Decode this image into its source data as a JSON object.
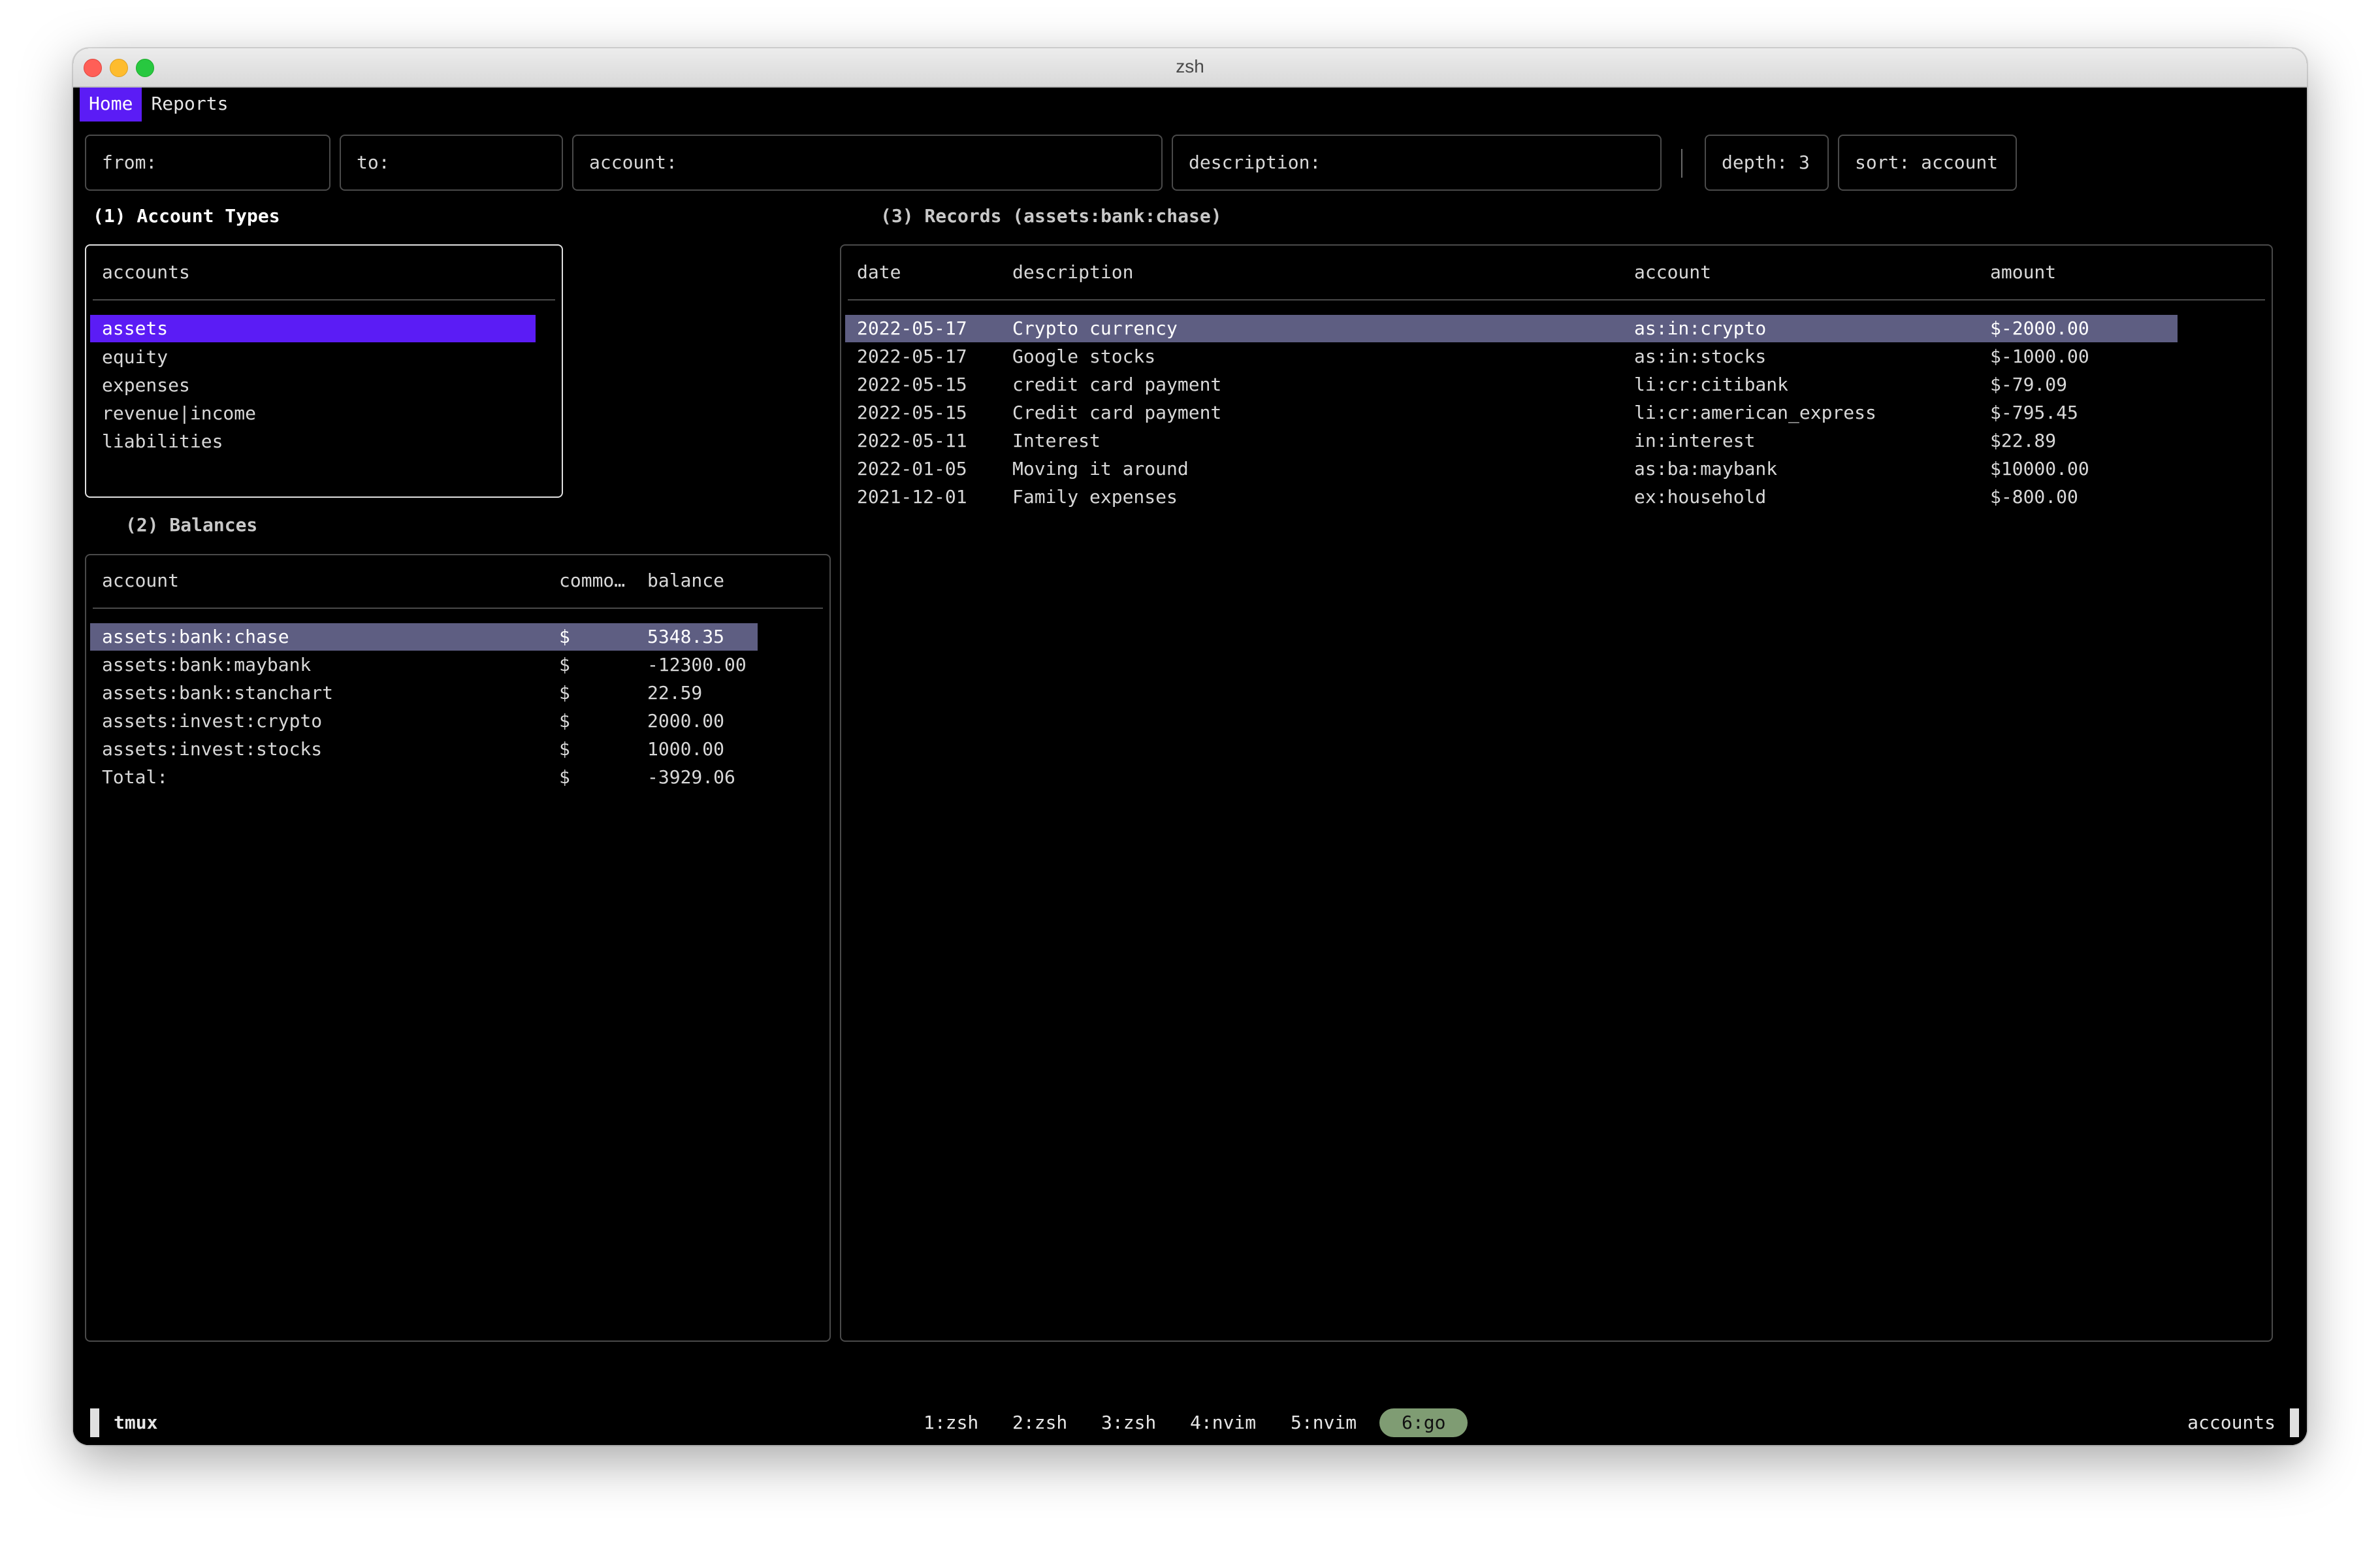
{
  "window": {
    "title": "zsh"
  },
  "nav": {
    "tabs": [
      "Home",
      "Reports"
    ]
  },
  "filters": {
    "from": "from:",
    "to": "to:",
    "account": "account:",
    "description": "description:",
    "depth": "depth: 3",
    "sort": "sort: account"
  },
  "account_types": {
    "title": "(1) Account Types",
    "header": "accounts",
    "items": [
      "assets",
      "equity",
      "expenses",
      "revenue|income",
      "liabilities"
    ]
  },
  "balances": {
    "title": "(2) Balances",
    "headers": [
      "account",
      "commo…",
      "balance"
    ],
    "rows": [
      [
        "assets:bank:chase",
        "$",
        "5348.35"
      ],
      [
        "assets:bank:maybank",
        "$",
        "-12300.00"
      ],
      [
        "assets:bank:stanchart",
        "$",
        "22.59"
      ],
      [
        "assets:invest:crypto",
        "$",
        "2000.00"
      ],
      [
        "assets:invest:stocks",
        "$",
        "1000.00"
      ],
      [
        "Total:",
        "$",
        "-3929.06"
      ]
    ]
  },
  "records": {
    "title": "(3) Records (assets:bank:chase)",
    "headers": [
      "date",
      "description",
      "account",
      "amount"
    ],
    "rows": [
      [
        "2022-05-17",
        "Crypto currency",
        "as:in:crypto",
        "$-2000.00"
      ],
      [
        "2022-05-17",
        "Google stocks",
        "as:in:stocks",
        "$-1000.00"
      ],
      [
        "2022-05-15",
        "credit card payment",
        "li:cr:citibank",
        "$-79.09"
      ],
      [
        "2022-05-15",
        "Credit card payment",
        "li:cr:american_express",
        "$-795.45"
      ],
      [
        "2022-05-11",
        "Interest",
        "in:interest",
        "$22.89"
      ],
      [
        "2022-01-05",
        "Moving it around",
        "as:ba:maybank",
        "$10000.00"
      ],
      [
        "2021-12-01",
        "Family expenses",
        "ex:household",
        "$-800.00"
      ]
    ]
  },
  "statusbar": {
    "session": "tmux",
    "windows": [
      "1:zsh",
      "2:zsh",
      "3:zsh",
      "4:nvim",
      "5:nvim",
      "6:go"
    ],
    "right": "accounts"
  },
  "colors": {
    "accent": "#5b1cf5",
    "row_highlight": "#5e5e82",
    "active_window": "#7f9c73"
  }
}
